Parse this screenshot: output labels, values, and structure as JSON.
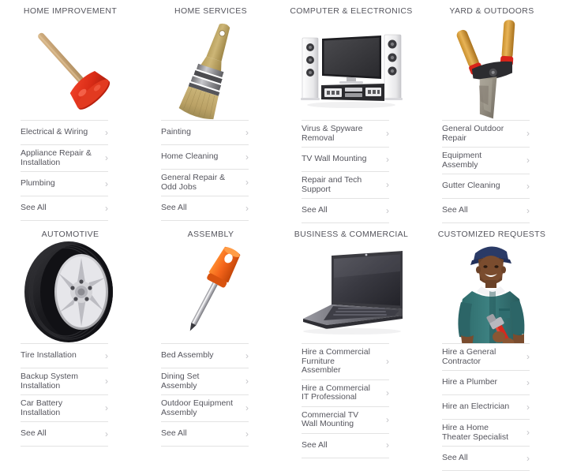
{
  "theme": {
    "background": "#ffffff",
    "text_color": "#55555d",
    "separator_color": "#e3e3e3",
    "chevron_color": "#c4c4c8"
  },
  "chevron_glyph": "›",
  "categories": [
    {
      "title": "HOME IMPROVEMENT",
      "image": "plunger",
      "links": [
        {
          "label": "Electrical & Wiring"
        },
        {
          "label": "Appliance Repair & Installation"
        },
        {
          "label": "Plumbing"
        },
        {
          "label": "See All"
        }
      ]
    },
    {
      "title": "HOME SERVICES",
      "image": "paintbrush",
      "links": [
        {
          "label": "Painting"
        },
        {
          "label": "Home Cleaning"
        },
        {
          "label": "General Repair & Odd Jobs"
        },
        {
          "label": "See All"
        }
      ]
    },
    {
      "title": "COMPUTER & ELECTRONICS",
      "image": "tv-home-theater",
      "links": [
        {
          "label": "Virus & Spyware Removal"
        },
        {
          "label": "TV Wall Mounting"
        },
        {
          "label": "Repair and Tech Support"
        },
        {
          "label": "See All"
        }
      ]
    },
    {
      "title": "YARD & OUTDOORS",
      "image": "hedge-shears",
      "links": [
        {
          "label": "General Outdoor Repair"
        },
        {
          "label": "Equipment Assembly"
        },
        {
          "label": "Gutter Cleaning"
        },
        {
          "label": "See All"
        }
      ]
    },
    {
      "title": "AUTOMOTIVE",
      "image": "tire-wheel",
      "links": [
        {
          "label": "Tire Installation"
        },
        {
          "label": "Backup System Installation"
        },
        {
          "label": "Car Battery Installation"
        },
        {
          "label": "See All"
        }
      ]
    },
    {
      "title": "ASSEMBLY",
      "image": "screwdriver",
      "links": [
        {
          "label": "Bed Assembly"
        },
        {
          "label": "Dining Set Assembly"
        },
        {
          "label": "Outdoor Equipment Assembly"
        },
        {
          "label": "See All"
        }
      ]
    },
    {
      "title": "BUSINESS & COMMERCIAL",
      "image": "laptop",
      "links": [
        {
          "label": "Hire a Commercial Furniture Assembler"
        },
        {
          "label": "Hire a Commercial IT Professional"
        },
        {
          "label": "Commercial TV Wall Mounting"
        },
        {
          "label": "See All"
        }
      ]
    },
    {
      "title": "CUSTOMIZED REQUESTS",
      "image": "technician-with-wrench",
      "links": [
        {
          "label": "Hire a General Contractor"
        },
        {
          "label": "Hire a Plumber"
        },
        {
          "label": "Hire an Electrician"
        },
        {
          "label": "Hire a Home Theater Specialist"
        },
        {
          "label": "See All"
        }
      ]
    }
  ]
}
